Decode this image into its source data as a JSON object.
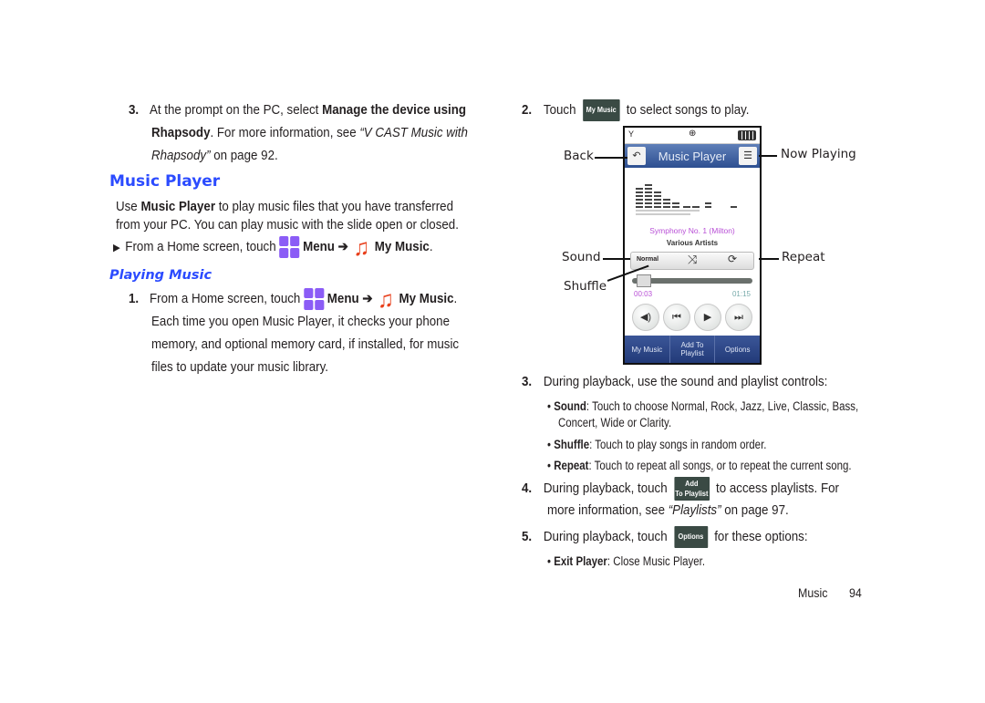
{
  "left_column": {
    "step3": {
      "number": "3.",
      "line1_pre": "At the prompt on the PC, select ",
      "line1_bold": "Manage the device using",
      "line2_bold": "Rhapsody",
      "line2_rest": ". For more information, see ",
      "line2_italic": "“V CAST Music with",
      "line3_italic": "Rhapsody”",
      "line3_rest": " on page 92."
    },
    "heading": "Music Player",
    "intro": {
      "pre": "Use ",
      "bold": "Music Player",
      "line1_rest": " to play music files that you have transferred",
      "line2": "from your PC. You can play music with the slide open or closed."
    },
    "bullet_step": {
      "marker": "▶",
      "pre": "From a Home screen, touch",
      "menu_label": "Menu ➔",
      "my_music_label": "My Music",
      "end": "."
    },
    "subheading": "Playing Music",
    "step1": {
      "number": "1.",
      "pre": "From a Home screen, touch",
      "menu_label": "Menu ➔",
      "my_music_label": "My Music",
      "end": ".",
      "line2": "Each time you open Music Player, it checks your phone",
      "line3": "memory, and optional memory card, if installed, for music",
      "line4": "files to update your music library."
    }
  },
  "right_column": {
    "step2": {
      "number": "2.",
      "pre": "Touch",
      "button_label": "My Music",
      "post": "to select songs to play."
    },
    "phone": {
      "title": "Music Player",
      "track": "Symphony No. 1 (Milton)",
      "artist": "Various Artists",
      "sound_mode": "Normal",
      "elapsed": "00:03",
      "total": "01:15",
      "progress_fraction": 0.04,
      "softkeys": [
        "My Music",
        "Add To Playlist",
        "Options"
      ],
      "colors": {
        "track": "#b84fd6",
        "titlebar": "#2d4f91"
      }
    },
    "callouts": {
      "back": "Back",
      "sound": "Sound",
      "shuffle": "Shuffle",
      "now_playing": "Now Playing",
      "repeat": "Repeat"
    },
    "step3": {
      "number": "3.",
      "text": "During playback, use the sound and playlist controls:",
      "bullets": [
        {
          "bold": "Sound",
          "text": ": Touch to choose Normal, Rock, Jazz, Live, Classic, Bass,",
          "cont": "Concert, Wide or Clarity."
        },
        {
          "bold": "Shuffle",
          "text": ": Touch to play songs in random order."
        },
        {
          "bold": "Repeat",
          "text": ": Touch to repeat all songs, or to repeat the current song."
        }
      ]
    },
    "step4": {
      "number": "4.",
      "pre": "During playback, touch",
      "button_line1": "Add",
      "button_line2": "To Playlist",
      "post": "to access playlists. For",
      "line2_pre": "more information, see ",
      "line2_italic": "“Playlists”",
      "line2_post": " on page 97."
    },
    "step5": {
      "number": "5.",
      "pre": "During playback, touch",
      "button_label": "Options",
      "post": "for these options:",
      "bullet_bold": "Exit Player",
      "bullet_text": ": Close Music Player."
    }
  },
  "footer": {
    "section": "Music",
    "page": "94"
  }
}
